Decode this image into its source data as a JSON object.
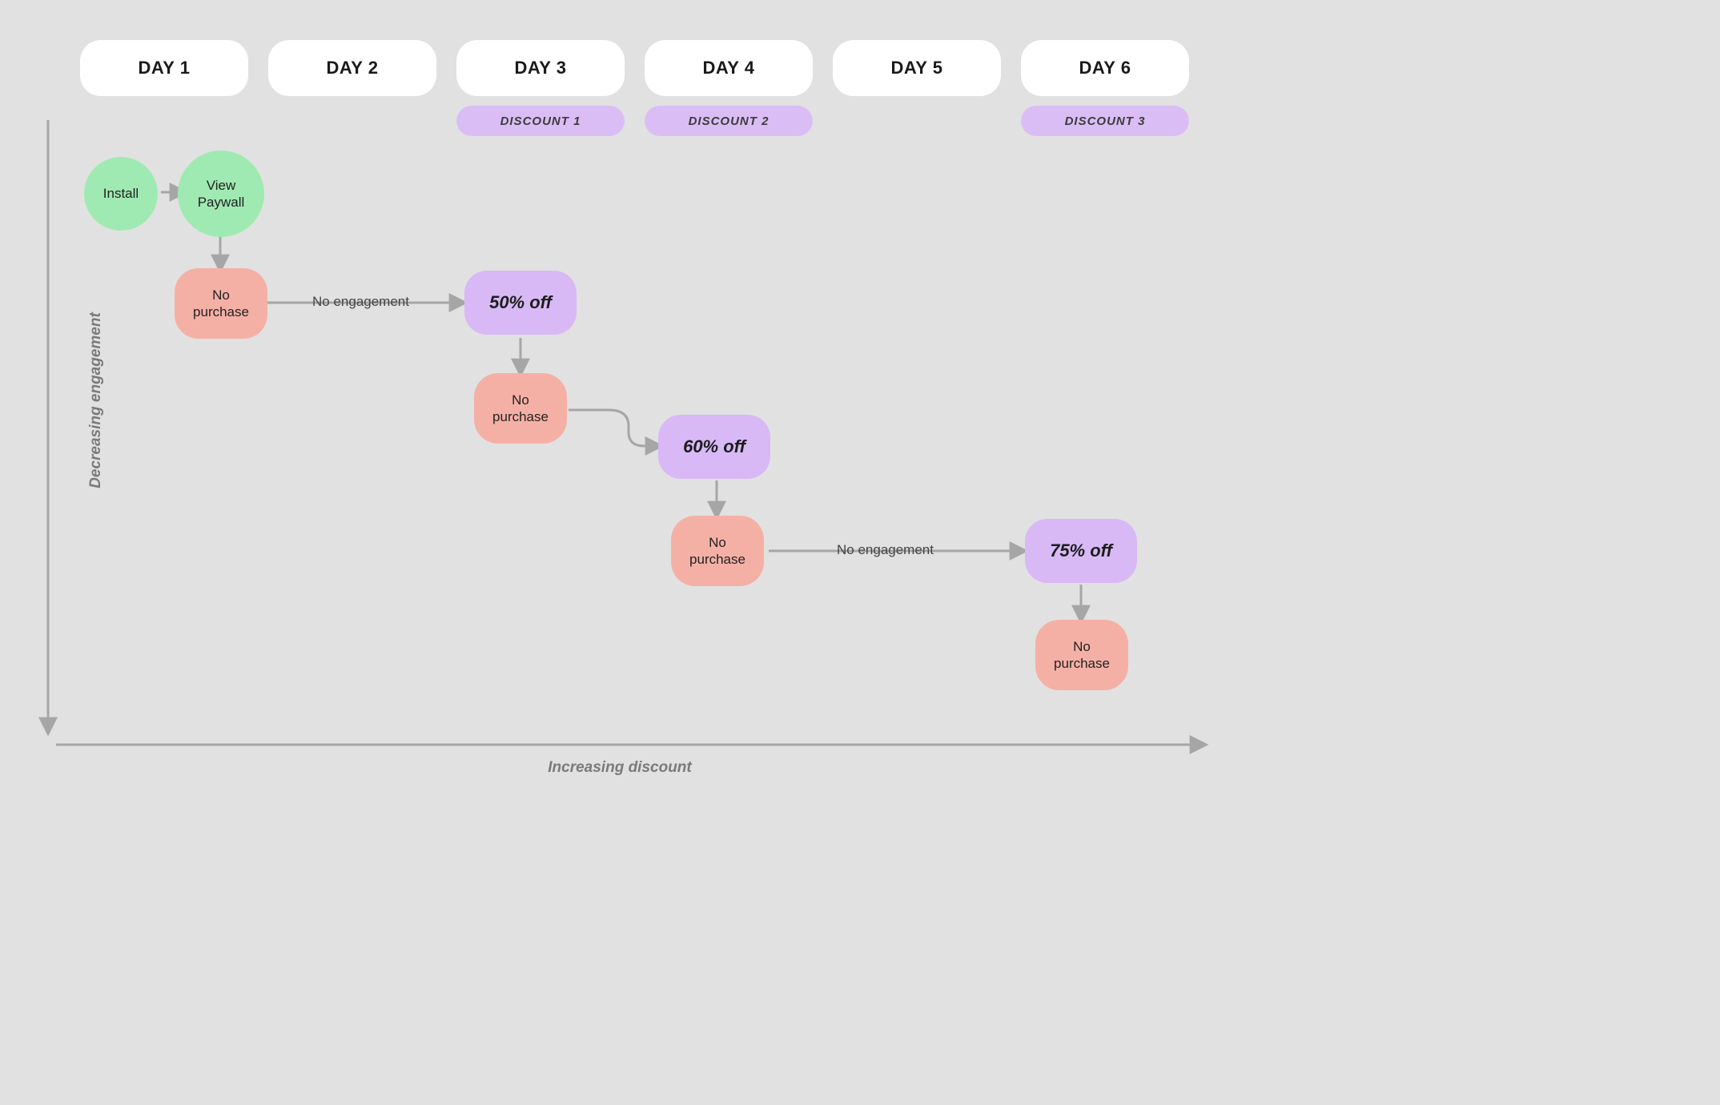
{
  "days": [
    "DAY 1",
    "DAY 2",
    "DAY 3",
    "DAY 4",
    "DAY 5",
    "DAY 6"
  ],
  "discount_tags": {
    "d3": "DISCOUNT 1",
    "d4": "DISCOUNT 2",
    "d6": "DISCOUNT 3"
  },
  "nodes": {
    "install": "Install",
    "view_paywall": "View\nPaywall",
    "no_purchase_1": "No\npurchase",
    "off50": "50% off",
    "no_purchase_2": "No\npurchase",
    "off60": "60% off",
    "no_purchase_3": "No\npurchase",
    "off75": "75% off",
    "no_purchase_4": "No\npurchase"
  },
  "edge_labels": {
    "no_engagement_1": "No engagement",
    "no_engagement_2": "No engagement"
  },
  "axes": {
    "y": "Decreasing engagement",
    "x": "Increasing discount"
  }
}
